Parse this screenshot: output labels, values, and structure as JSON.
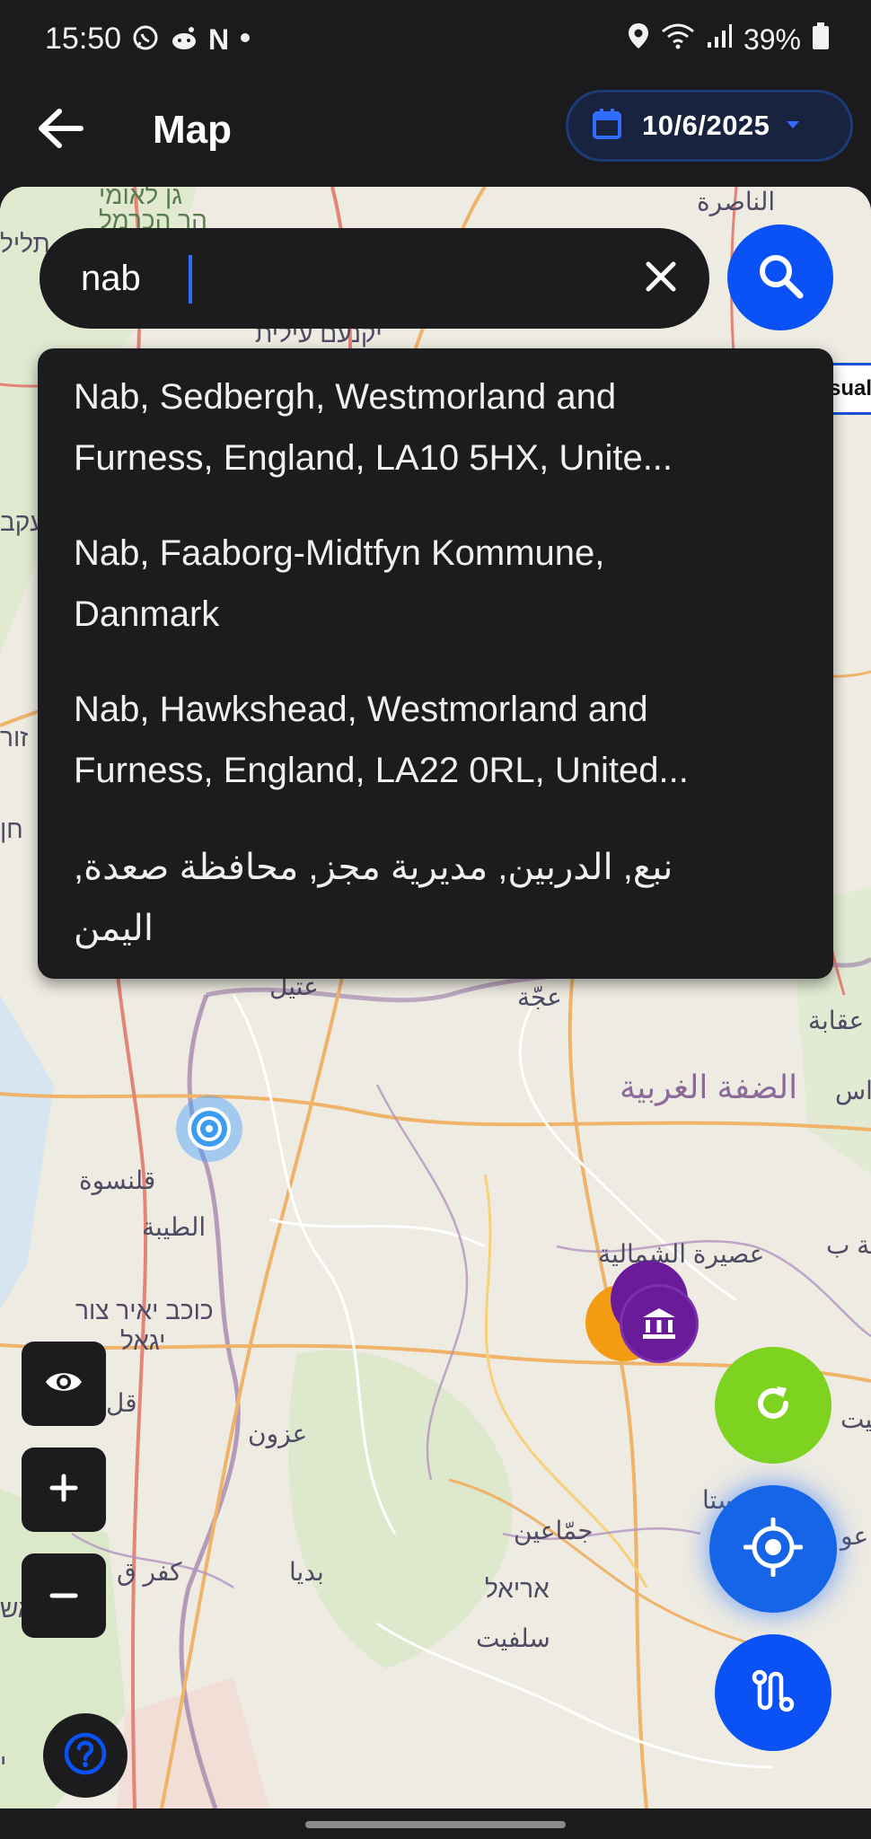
{
  "status_bar": {
    "time": "15:50",
    "battery": "39%",
    "left_icons": [
      "whatsapp-icon",
      "reddit-icon",
      "netflix-icon",
      "dot-icon"
    ],
    "right_icons": [
      "location-icon",
      "wifi-icon",
      "signal-icon",
      "battery-icon"
    ],
    "netflix_letter": "N"
  },
  "app_bar": {
    "title": "Map",
    "date": "10/6/2025"
  },
  "search": {
    "value": "nab",
    "partial_chip": "sual"
  },
  "suggestions": [
    {
      "line1": "Nab, Sedbergh, Westmorland and",
      "line2": "Furness, England, LA10 5HX, Unite..."
    },
    {
      "line1": "Nab, Faaborg-Midtfyn Kommune,",
      "line2": "Danmark"
    },
    {
      "line1": "Nab, Hawkshead, Westmorland and",
      "line2": "Furness, England, LA22 0RL, United..."
    },
    {
      "line1": "نبع, الدربين, مديرية مجز, محافظة صعدة,",
      "line2": "اليمن"
    }
  ],
  "map_labels": {
    "nazareth": "الناصرة",
    "top_hebrew": "גן לאומי",
    "top_hebrew2": "הר הכרמל",
    "left_edge1": "תליל",
    "yokneam": "יקנעם עילית",
    "left_edge2": "עקב",
    "left_edge3": "זור",
    "left_edge4": "חן",
    "attil": "عتيل",
    "ajja": "عجّة",
    "aqaba": "عقابة",
    "west_bank": "الضفة الغربية",
    "right_edge1": "اس",
    "qalansawe": "قلنسوة",
    "taybe": "الطيبة",
    "asira": "عصيرة الشمالية",
    "right_edge2": "قة ب",
    "kochav_yair": "כוכב יאיר צור",
    "yigal": "יגאל",
    "qal": "قل",
    "azzun": "عزون",
    "right_edge3": "بيت",
    "right_edge4": "ستا",
    "jammain": "جمّاعين",
    "right_edge5": "عو",
    "kafr_qasim": "كفر ق",
    "budya": "بديا",
    "ariel": "אריאל",
    "salfit": "سلفيت",
    "bottom_left1": "ראש",
    "bottom_left2": "י"
  },
  "colors": {
    "primary": "#0a52f5",
    "refresh": "#7ed321",
    "surface": "#1c1c1e",
    "map_bg": "#efece3",
    "marker_orange": "#f39c12",
    "marker_purple": "#6a1b9a"
  }
}
